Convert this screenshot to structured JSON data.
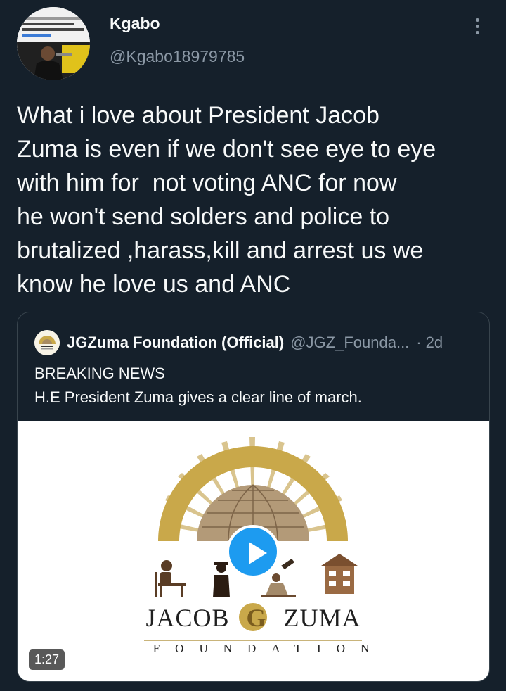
{
  "author": {
    "name": "Kgabo",
    "handle": "@Kgabo18979785",
    "avatar_icon": "news-thumbnail-avatar"
  },
  "more_icon": "more-vertical-icon",
  "tweet": {
    "text": "What i love about President Jacob\nZuma is even if we don't see eye to eye\nwith him for  not voting ANC for now\nhe won't send solders and police to\nbrutalized ,harass,kill and arrest us we\nknow he love us and ANC"
  },
  "quoted": {
    "name": "JGZuma Foundation (Official)",
    "handle": "@JGZ_Founda...",
    "separator": "·",
    "time": "2d",
    "line1": "BREAKING NEWS",
    "line2": "H.E President Zuma gives a clear line of march.",
    "media": {
      "logo_title_left": "JACOB",
      "logo_title_mid": "G",
      "logo_title_right": "ZUMA",
      "logo_subtitle": "FOUNDATION",
      "duration": "1:27",
      "play_icon": "play-icon"
    }
  },
  "colors": {
    "background": "#15202b",
    "accent": "#1d9bf0",
    "secondary_text": "#8b98a5",
    "logo_gold": "#c9a84a"
  }
}
